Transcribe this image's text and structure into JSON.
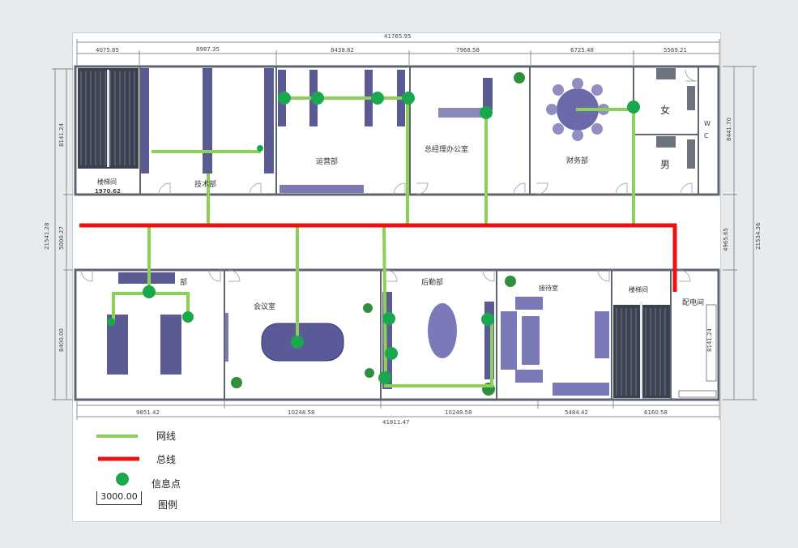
{
  "dimensions": {
    "top_total": "41765.95",
    "top_segments": [
      "4075.85",
      "8987.35",
      "8438.82",
      "7968.58",
      "6725.48",
      "5569.21"
    ],
    "bottom_total": "41811.47",
    "bottom_segments": [
      "9851.42",
      "10248.58",
      "10248.58",
      "5484.42",
      "6160.58"
    ],
    "left_total": "21541.28",
    "left_upper": "8141.24",
    "left_middle": "5000.27",
    "left_lower": "8400.00",
    "right_total": "21534.36",
    "right_upper": "8441.70",
    "right_middle": "4965.65",
    "right_lower": "8141.24",
    "stair_width": "1970.62"
  },
  "rooms": {
    "stair_top": "楼梯间",
    "tech": "技术部",
    "ops": "运营部",
    "gm_office": "总经理办公室",
    "finance": "财务部",
    "female": "女",
    "male": "男",
    "wc_w": "W",
    "wc_c": "C",
    "dept_partial": "部",
    "meeting": "会议室",
    "logistics": "后勤部",
    "reception": "接待室",
    "stair_bottom": "楼梯间",
    "power": "配电间"
  },
  "legend": {
    "network_line": "网线",
    "bus_line": "总线",
    "info_point": "信息点",
    "scale_value": "3000.00",
    "legend_title": "图例"
  },
  "colors": {
    "network": "#8dcf5a",
    "bus": "#ee1111",
    "point": "#1aa84f",
    "furniture": "#5b5b94",
    "wall": "#5d6472"
  }
}
